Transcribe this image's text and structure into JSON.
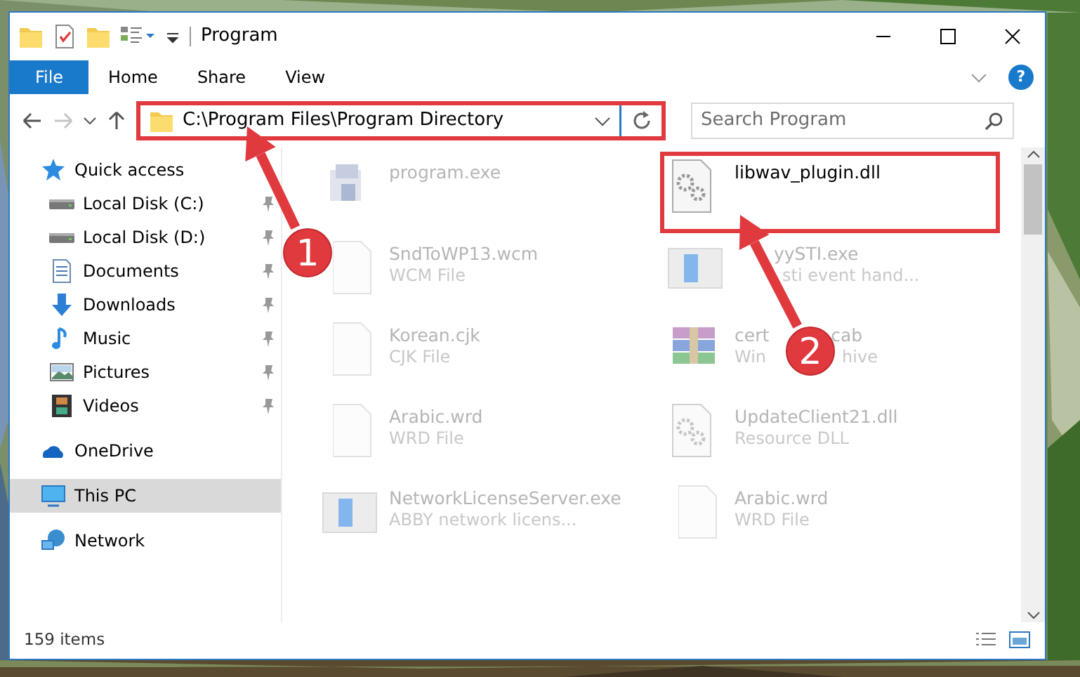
{
  "window": {
    "title": "Program"
  },
  "ribbon_tabs": [
    {
      "label": "File",
      "selected": true
    },
    {
      "label": "Home",
      "selected": false
    },
    {
      "label": "Share",
      "selected": false
    },
    {
      "label": "View",
      "selected": false
    }
  ],
  "help": {
    "label": "?"
  },
  "address": {
    "path": "C:\\Program Files\\Program Directory",
    "highlighted": true
  },
  "search": {
    "placeholder": "Search Program"
  },
  "sidebar": {
    "items": [
      {
        "label": "Quick access",
        "kind": "star",
        "selected": false,
        "children": [
          {
            "label": "Local Disk (C:)",
            "kind": "disk",
            "pinned": true,
            "selected": false
          },
          {
            "label": "Local Disk (D:)",
            "kind": "disk",
            "pinned": true,
            "selected": false
          },
          {
            "label": "Documents",
            "kind": "documents",
            "pinned": true,
            "selected": false
          },
          {
            "label": "Downloads",
            "kind": "downloads",
            "pinned": true,
            "selected": false
          },
          {
            "label": "Music",
            "kind": "music",
            "pinned": true,
            "selected": false
          },
          {
            "label": "Pictures",
            "kind": "pictures",
            "pinned": true,
            "selected": false
          },
          {
            "label": "Videos",
            "kind": "videos",
            "pinned": true,
            "selected": false
          }
        ]
      },
      {
        "label": "OneDrive",
        "kind": "cloud",
        "selected": false
      },
      {
        "label": "This PC",
        "kind": "pc",
        "selected": true
      },
      {
        "label": "Network",
        "kind": "network",
        "selected": false
      }
    ]
  },
  "files": [
    {
      "name": "program.exe",
      "kind": "installer",
      "highlighted": false
    },
    {
      "name": "libwav_plugin.dll",
      "kind": "dll",
      "highlighted": true
    },
    {
      "name": "SndToWP13.wcm",
      "type": "WCM File",
      "kind": "blank",
      "highlighted": false
    },
    {
      "name": "yySTI.exe",
      "type": "sti event hand...",
      "kind": "app",
      "partly_hidden": true,
      "highlighted": false
    },
    {
      "name": "Korean.cjk",
      "type": "CJK File",
      "kind": "blank",
      "highlighted": false
    },
    {
      "name_parts": [
        "cert",
        "cab"
      ],
      "type_parts": [
        "Win",
        "hive"
      ],
      "kind": "archive",
      "highlighted": false
    },
    {
      "name": "Arabic.wrd",
      "type": "WRD File",
      "kind": "blank",
      "highlighted": false
    },
    {
      "name": "UpdateClient21.dll",
      "type": "Resource DLL",
      "kind": "dll",
      "highlighted": false
    },
    {
      "name": "NetworkLicenseServer.exe",
      "type": "ABBY network licens...",
      "kind": "app",
      "highlighted": false
    },
    {
      "name": "Arabic.wrd",
      "type": "WRD File",
      "kind": "blank",
      "highlighted": false
    }
  ],
  "status_bar": {
    "count": "159 items"
  },
  "annotations": [
    {
      "number": "1"
    },
    {
      "number": "2"
    }
  ]
}
